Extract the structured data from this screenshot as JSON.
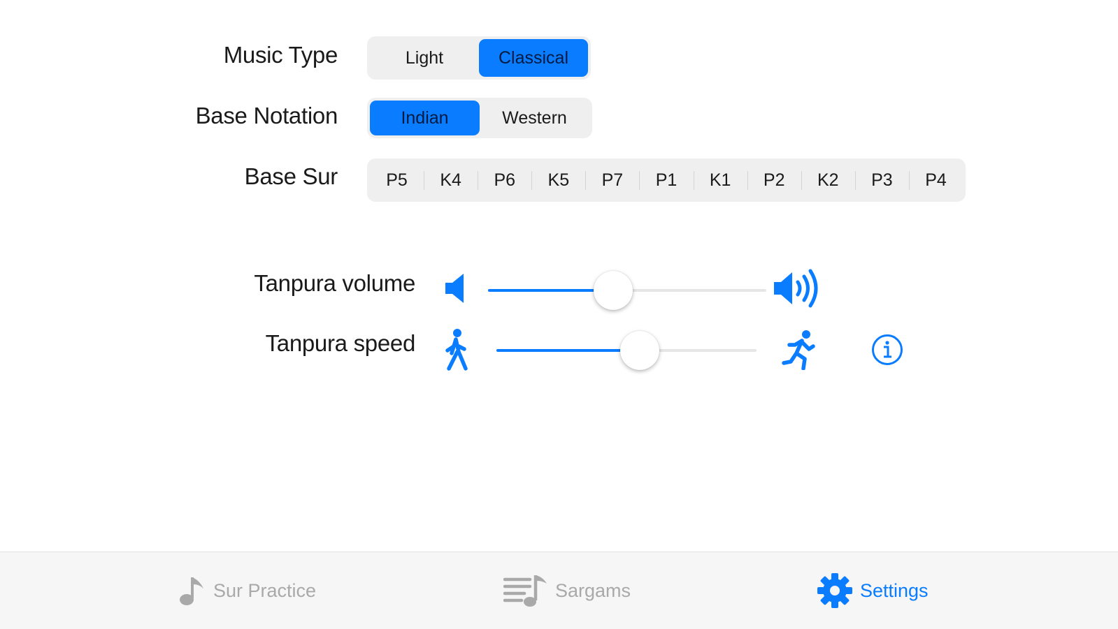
{
  "music_type": {
    "label": "Music Type",
    "options": [
      "Light",
      "Classical"
    ],
    "selected": "Classical"
  },
  "base_notation": {
    "label": "Base Notation",
    "options": [
      "Indian",
      "Western"
    ],
    "selected": "Indian"
  },
  "base_sur": {
    "label": "Base Sur",
    "options": [
      "P5",
      "K4",
      "P6",
      "K5",
      "P7",
      "P1",
      "K1",
      "P2",
      "K2",
      "P3",
      "P4"
    ],
    "selected": "K1"
  },
  "tanpura_volume": {
    "label": "Tanpura volume",
    "value_fraction": 0.45,
    "min_icon": "speaker-low-icon",
    "max_icon": "speaker-high-icon"
  },
  "tanpura_speed": {
    "label": "Tanpura speed",
    "value_fraction": 0.55,
    "min_icon": "walking-person-icon",
    "max_icon": "running-person-icon",
    "info_icon": "info-icon"
  },
  "tabbar": {
    "tabs": [
      {
        "label": "Sur Practice",
        "icon": "music-note-icon",
        "active": false
      },
      {
        "label": "Sargams",
        "icon": "playlist-icon",
        "active": false
      },
      {
        "label": "Settings",
        "icon": "gear-icon",
        "active": true
      }
    ]
  },
  "colors": {
    "accent": "#0a7cff",
    "segment_bg": "#efefef",
    "inactive_tab": "#a9a9a9"
  }
}
